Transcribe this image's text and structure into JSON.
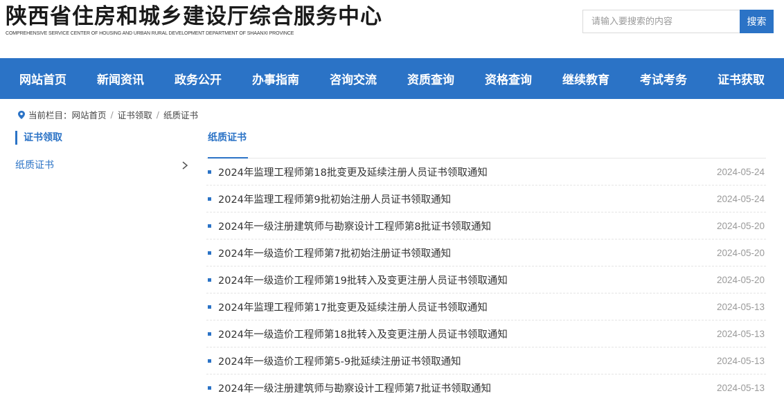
{
  "header": {
    "site_title": "陕西省住房和城乡建设厅综合服务中心",
    "site_subtitle": "COMPREHENSIVE SERVICE CENTER OF HOUSING AND URBAN RURAL DEVELOPMENT DEPARTMENT OF SHAANXI PROVINCE",
    "search_placeholder": "请输入要搜索的内容",
    "search_button": "搜索"
  },
  "nav": {
    "items": [
      "网站首页",
      "新闻资讯",
      "政务公开",
      "办事指南",
      "咨询交流",
      "资质查询",
      "资格查询",
      "继续教育",
      "考试考务",
      "证书获取"
    ]
  },
  "breadcrumb": {
    "prefix": "当前栏目：",
    "items": [
      "网站首页",
      "证书领取",
      "纸质证书"
    ],
    "separator": "/"
  },
  "sidebar": {
    "title": "证书领取",
    "items": [
      {
        "label": "纸质证书"
      }
    ]
  },
  "content": {
    "tab": "纸质证书",
    "list": [
      {
        "title": "2024年监理工程师第18批变更及延续注册人员证书领取通知",
        "date": "2024-05-24"
      },
      {
        "title": "2024年监理工程师第9批初始注册人员证书领取通知",
        "date": "2024-05-24"
      },
      {
        "title": "2024年一级注册建筑师与勘察设计工程师第8批证书领取通知",
        "date": "2024-05-20"
      },
      {
        "title": "2024年一级造价工程师第7批初始注册证书领取通知",
        "date": "2024-05-20"
      },
      {
        "title": "2024年一级造价工程师第19批转入及变更注册人员证书领取通知",
        "date": "2024-05-20"
      },
      {
        "title": "2024年监理工程师第17批变更及延续注册人员证书领取通知",
        "date": "2024-05-13"
      },
      {
        "title": "2024年一级造价工程师第18批转入及变更注册人员证书领取通知",
        "date": "2024-05-13"
      },
      {
        "title": "2024年一级造价工程师第5-9批延续注册证书领取通知",
        "date": "2024-05-13"
      },
      {
        "title": "2024年一级注册建筑师与勘察设计工程师第7批证书领取通知",
        "date": "2024-05-13"
      }
    ]
  },
  "colors": {
    "brand_blue": "#2b73c6",
    "text": "#333333",
    "muted": "#9a9a9a"
  },
  "icons": {
    "breadcrumb": "location-pin-icon",
    "sidebar_item": "chevron-right-icon",
    "list_item": "square-bullet-icon"
  }
}
